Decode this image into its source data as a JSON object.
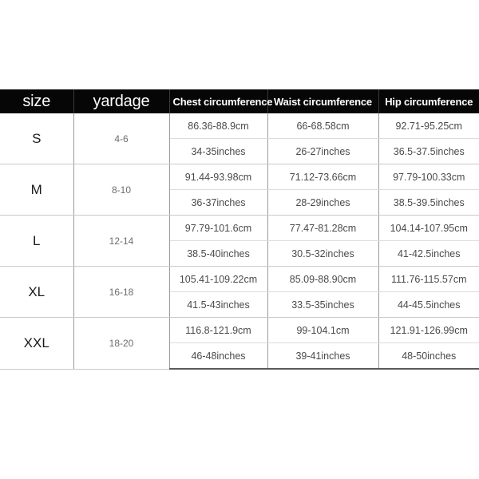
{
  "table": {
    "headers": [
      {
        "label": "size",
        "style": "big"
      },
      {
        "label": "yardage",
        "style": "big"
      },
      {
        "label": "Chest circumference",
        "style": "small"
      },
      {
        "label": "Waist circumference",
        "style": "small"
      },
      {
        "label": "Hip circumference",
        "style": "small"
      }
    ],
    "rows": [
      {
        "size": "S",
        "yardage": "4-6",
        "chest_cm": "86.36-88.9cm",
        "chest_in": "34-35inches",
        "waist_cm": "66-68.58cm",
        "waist_in": "26-27inches",
        "hip_cm": "92.71-95.25cm",
        "hip_in": "36.5-37.5inches"
      },
      {
        "size": "M",
        "yardage": "8-10",
        "chest_cm": "91.44-93.98cm",
        "chest_in": "36-37inches",
        "waist_cm": "71.12-73.66cm",
        "waist_in": "28-29inches",
        "hip_cm": "97.79-100.33cm",
        "hip_in": "38.5-39.5inches"
      },
      {
        "size": "L",
        "yardage": "12-14",
        "chest_cm": "97.79-101.6cm",
        "chest_in": "38.5-40inches",
        "waist_cm": "77.47-81.28cm",
        "waist_in": "30.5-32inches",
        "hip_cm": "104.14-107.95cm",
        "hip_in": "41-42.5inches"
      },
      {
        "size": "XL",
        "yardage": "16-18",
        "chest_cm": "105.41-109.22cm",
        "chest_in": "41.5-43inches",
        "waist_cm": "85.09-88.90cm",
        "waist_in": "33.5-35inches",
        "hip_cm": "111.76-115.57cm",
        "hip_in": "44-45.5inches"
      },
      {
        "size": "XXL",
        "yardage": "18-20",
        "chest_cm": "116.8-121.9cm",
        "chest_in": "46-48inches",
        "waist_cm": "99-104.1cm",
        "waist_in": "39-41inches",
        "hip_cm": "121.91-126.99cm",
        "hip_in": "48-50inches"
      }
    ]
  },
  "colors": {
    "header_background": "#060606",
    "header_text": "#ffffff",
    "page_background": "#ffffff",
    "size_text": "#1a1a1a",
    "yardage_text": "#6d6d6d",
    "measurement_text": "#4a4a4a",
    "grid_line": "#c9c9c9",
    "column_divider": "#9a9a9a"
  }
}
